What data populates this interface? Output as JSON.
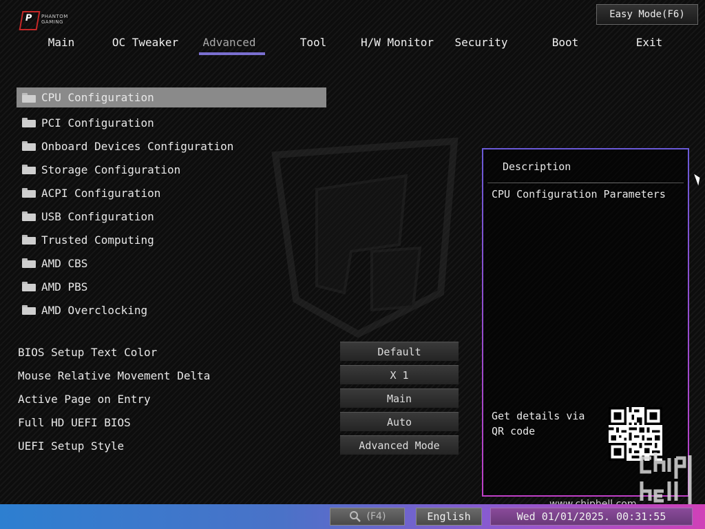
{
  "header": {
    "logo_text_line1": "PHANTOM",
    "logo_text_line2": "GAMING",
    "easy_mode_label": "Easy Mode(F6)"
  },
  "tabs": [
    {
      "label": "Main",
      "active": false
    },
    {
      "label": "OC Tweaker",
      "active": false
    },
    {
      "label": "Advanced",
      "active": true
    },
    {
      "label": "Tool",
      "active": false
    },
    {
      "label": "H/W Monitor",
      "active": false
    },
    {
      "label": "Security",
      "active": false
    },
    {
      "label": "Boot",
      "active": false
    },
    {
      "label": "Exit",
      "active": false
    }
  ],
  "menu": [
    {
      "label": "CPU Configuration",
      "icon": "folder-icon",
      "selected": true
    },
    {
      "label": "PCI Configuration",
      "icon": "folder-icon"
    },
    {
      "label": "Onboard Devices Configuration",
      "icon": "folder-icon"
    },
    {
      "label": "Storage Configuration",
      "icon": "folder-icon"
    },
    {
      "label": "ACPI Configuration",
      "icon": "folder-icon"
    },
    {
      "label": "USB Configuration",
      "icon": "folder-icon"
    },
    {
      "label": "Trusted Computing",
      "icon": "folder-icon"
    },
    {
      "label": "AMD CBS",
      "icon": "folder-icon"
    },
    {
      "label": "AMD PBS",
      "icon": "folder-icon"
    },
    {
      "label": "AMD Overclocking",
      "icon": "folder-icon"
    }
  ],
  "settings": [
    {
      "label": "BIOS Setup Text Color",
      "value": "Default"
    },
    {
      "label": "Mouse Relative Movement Delta",
      "value": "X 1"
    },
    {
      "label": "Active Page on Entry",
      "value": "Main"
    },
    {
      "label": "Full HD UEFI BIOS",
      "value": "Auto"
    },
    {
      "label": "UEFI Setup Style",
      "value": "Advanced Mode"
    }
  ],
  "description": {
    "title": "Description",
    "text": "CPU Configuration Parameters",
    "qr_text": "Get details via QR code"
  },
  "footer": {
    "search_label": "(F4)",
    "language": "English",
    "datetime": "Wed 01/01/2025. 00:31:55",
    "watermark_url": "www.chiphell.com"
  },
  "colors": {
    "tab_underline": "#7a6fd0",
    "selected_row": "#8a8a8a",
    "bottom_bar_start": "#2d7fd0",
    "bottom_bar_end": "#d040b8"
  }
}
